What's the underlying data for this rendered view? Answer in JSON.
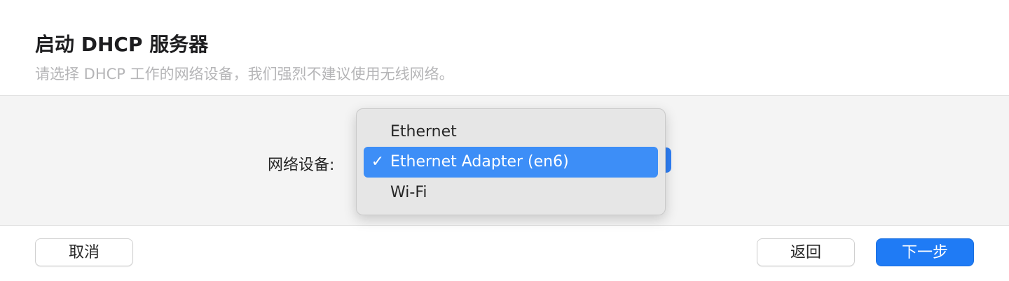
{
  "dialog": {
    "title": "启动 DHCP 服务器",
    "subtitle": "请选择 DHCP 工作的网络设备，我们强烈不建议使用无线网络。"
  },
  "form": {
    "network_device_label": "网络设备:",
    "selected_value": "Ethernet Adapter (en6)"
  },
  "menu": {
    "items": [
      {
        "label": "Ethernet",
        "checked": false
      },
      {
        "label": "Ethernet Adapter (en6)",
        "checked": true,
        "check_mark": "✓"
      },
      {
        "label": "Wi-Fi",
        "checked": false
      }
    ]
  },
  "footer": {
    "cancel_label": "取消",
    "back_label": "返回",
    "next_label": "下一步"
  },
  "colors": {
    "accent": "#1f7bf5",
    "menu_highlight": "#3d8ef7",
    "subtitle_text": "#b5b5b7"
  }
}
